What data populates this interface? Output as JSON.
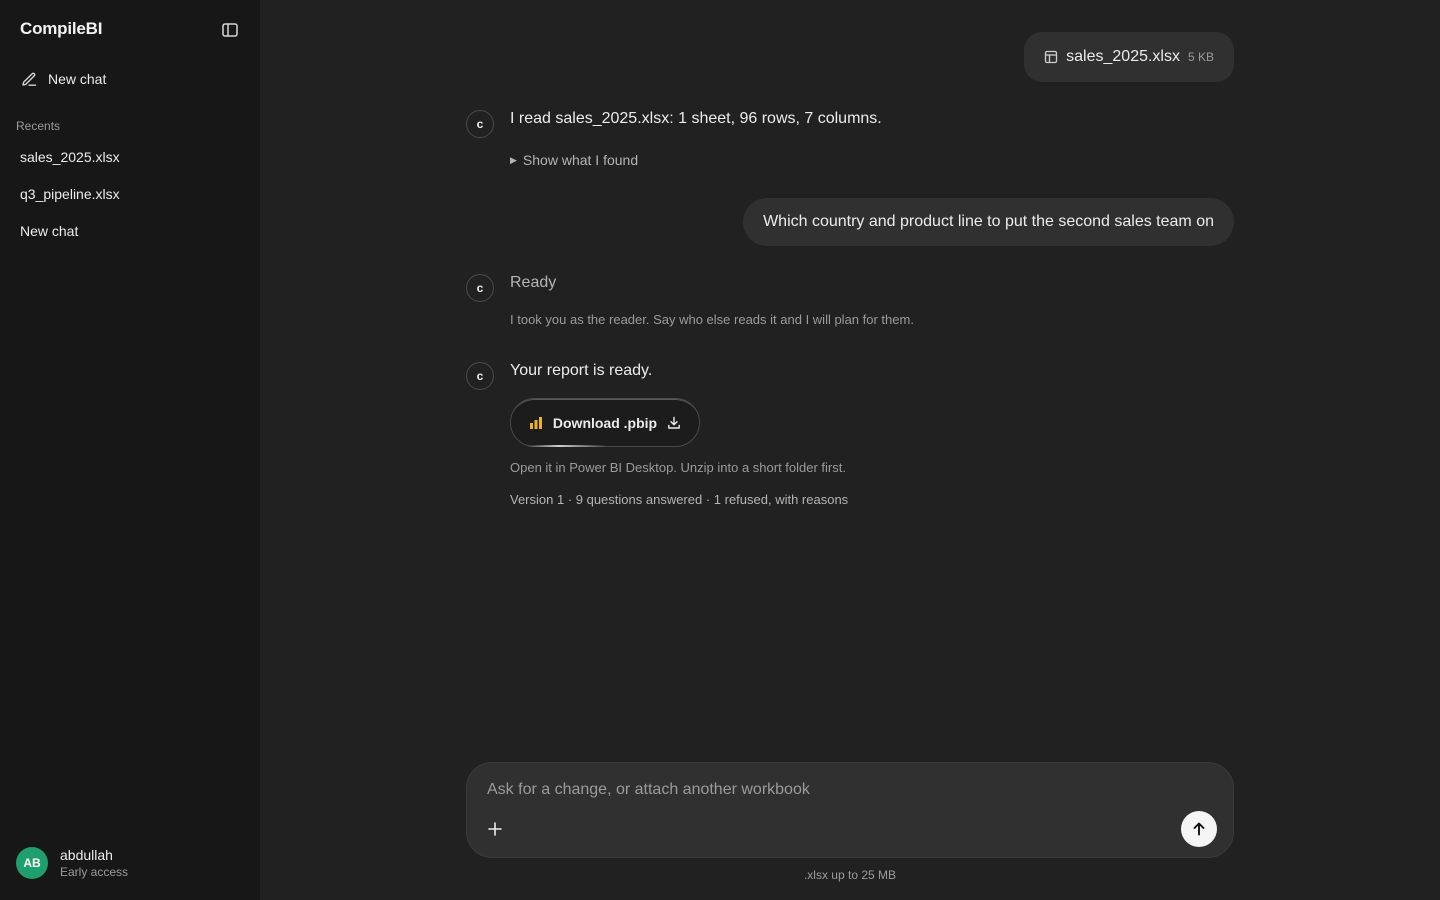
{
  "sidebar": {
    "brand": "CompileBI",
    "new_chat": "New chat",
    "recents_label": "Recents",
    "recents": [
      "sales_2025.xlsx",
      "q3_pipeline.xlsx",
      "New chat"
    ],
    "user": {
      "initials": "AB",
      "name": "abdullah",
      "plan": "Early access"
    }
  },
  "chat": {
    "attachment": {
      "name": "sales_2025.xlsx",
      "size": "5 KB",
      "icon": "table-icon"
    },
    "bot_initial": "c",
    "read_summary": "I read sales_2025.xlsx: 1 sheet, 96 rows, 7 columns.",
    "show_found": "Show what I found",
    "user_question": "Which country and product line to put the second sales team on",
    "ready_title": "Ready",
    "ready_sub": "I took you as the reader. Say who else reads it and I will plan for them.",
    "report_ready": "Your report is ready.",
    "download_label": "Download .pbip",
    "report_note": "Open it in Power BI Desktop. Unzip into a short folder first.",
    "report_meta": "Version 1 · 9 questions answered · 1 refused, with reasons"
  },
  "composer": {
    "placeholder": "Ask for a change, or attach another workbook",
    "hint": ".xlsx up to 25 MB"
  },
  "colors": {
    "background": "#212121",
    "sidebar": "#171717",
    "bubble": "#303030",
    "avatar": "#1f9e6e",
    "chart_accent": "#e8b32b"
  }
}
